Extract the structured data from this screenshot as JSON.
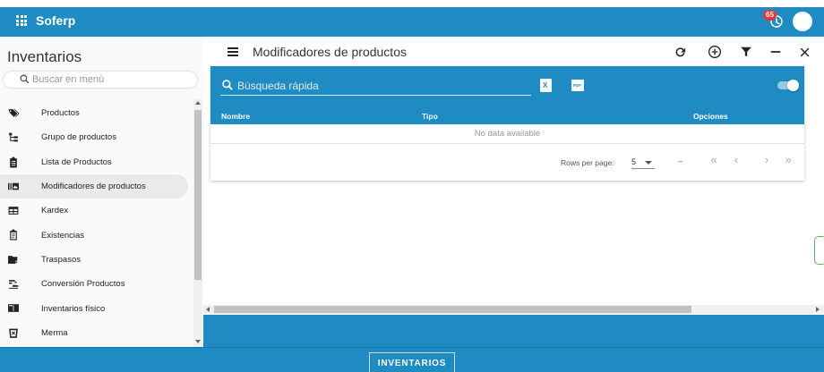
{
  "app": {
    "brand": "Soferp",
    "notification_count": "65"
  },
  "sidebar": {
    "title": "Inventarios",
    "search_placeholder": "Buscar en menú",
    "items": [
      {
        "label": "Productos",
        "icon": "tag-icon",
        "active": false
      },
      {
        "label": "Grupo de productos",
        "icon": "hierarchy-icon",
        "active": false
      },
      {
        "label": "Lista de Productos",
        "icon": "clipboard-list-icon",
        "active": false
      },
      {
        "label": "Modificadores de productos",
        "icon": "barcode-book-icon",
        "active": true
      },
      {
        "label": "Kardex",
        "icon": "table-icon",
        "active": false
      },
      {
        "label": "Existencias",
        "icon": "clipboard-icon",
        "active": false
      },
      {
        "label": "Traspasos",
        "icon": "folder-transfer-icon",
        "active": false
      },
      {
        "label": "Conversión Productos",
        "icon": "conversion-icon",
        "active": false
      },
      {
        "label": "Inventarios físico",
        "icon": "book-open-icon",
        "active": false
      },
      {
        "label": "Merma",
        "icon": "trash-icon",
        "active": false
      }
    ]
  },
  "main": {
    "title": "Modificadores de productos",
    "toolbar": [
      "refresh-icon",
      "add-circle-icon",
      "filter-icon",
      "minimize-icon",
      "close-icon"
    ],
    "quick_search_placeholder": "Búsqueda rápida",
    "columns": [
      "Nombre",
      "Tipo",
      "Opciones"
    ],
    "empty_text": "No data available",
    "pagination": {
      "rows_per_page_label": "Rows per page:",
      "rows_per_page": "5",
      "range": "–"
    }
  },
  "footer": {
    "tab_label": "INVENTARIOS"
  },
  "colors": {
    "primary": "#1e8bc3",
    "highlight": "#e0101a",
    "active_item_bg": "#eaeaea"
  }
}
